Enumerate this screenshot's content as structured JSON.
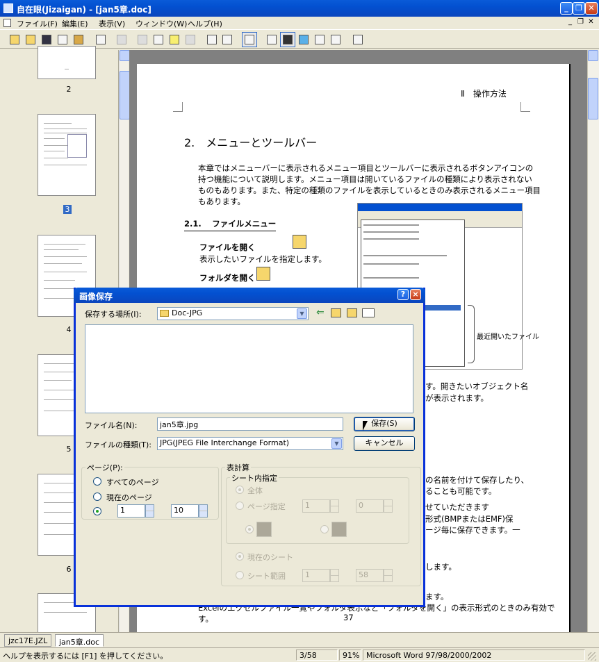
{
  "window": {
    "title": "自在眼(Jizaigan) - [jan5章.doc]"
  },
  "menubar": {
    "items": [
      "ファイル(F)",
      "編集(E)",
      "表示(V)",
      "ウィンドウ(W)",
      "ヘルプ(H)"
    ]
  },
  "thumbnails": {
    "labels": [
      "2",
      "3",
      "4",
      "5",
      "6"
    ],
    "selected": "3"
  },
  "document": {
    "header": "Ⅱ　操作方法",
    "chapter_title": "2.　メニューとツールバー",
    "intro": [
      "本章ではメニューバーに表示されるメニュー項目とツールバーに表示されるボタンアイコンの",
      "持つ機能について説明します。メニュー項目は開いているファイルの種類により表示されない",
      "ものもあります。また、特定の種類のファイルを表示しているときのみ表示されるメニュー項目",
      "もあります。"
    ],
    "section_title": "2.1.　 ファイルメニュー",
    "open_file_heading": "ファイルを開く",
    "open_file_desc": "表示したいファイルを指定します。",
    "open_folder_heading": "フォルダを開く",
    "embed_callout": "最近開いたファイル",
    "fragments": [
      "す。開きたいオブジェクト名",
      "が表示されます。",
      "の名前を付けて保存したり、",
      "ることも可能です。",
      "せていただきます",
      "形式(BMPまたはEMF)保",
      "ージ毎に保存できます。一",
      "します。",
      "ます。"
    ],
    "bottom_line": "Excelのエクセルファイル一覧やフォルダ表示など「フォルダを開く」の表示形式のときのみ有効で",
    "bottom_line2": "す。",
    "page_number": "37"
  },
  "dialog": {
    "title": "画像保存",
    "help_button": "?",
    "close_button": "×",
    "save_location_label": "保存する場所(I):",
    "save_location_value": "Doc-JPG",
    "filename_label": "ファイル名(N):",
    "filename_value": "jan5章.jpg",
    "filetype_label": "ファイルの種類(T):",
    "filetype_value": "JPG(JPEG File Interchange Format)",
    "save_button": "保存(S)",
    "cancel_button": "キャンセル",
    "page_group": {
      "label": "ページ(P):",
      "all_pages": "すべてのページ",
      "current_page": "現在のページ",
      "range_from": "1",
      "range_to": "10"
    },
    "sheet_group": {
      "label": "表計算",
      "inner_label": "シート内指定",
      "all": "全体",
      "page_spec": "ページ指定",
      "page_spec_from": "1",
      "page_spec_to": "0",
      "current_sheet": "現在のシート",
      "sheet_range": "シート範囲",
      "sheet_range_from": "1",
      "sheet_range_to": "58"
    }
  },
  "tabs": [
    "jzc17E.JZL",
    "jan5章.doc"
  ],
  "statusbar": {
    "help_text": "ヘルプを表示するには [F1] を押してください。",
    "page": "3/58",
    "zoom": "91%",
    "format": "Microsoft Word 97/98/2000/2002"
  },
  "colors": {
    "titlebar": "#0350d0",
    "selection": "#316ac5",
    "workspace": "#808080",
    "face": "#ece9d8"
  }
}
